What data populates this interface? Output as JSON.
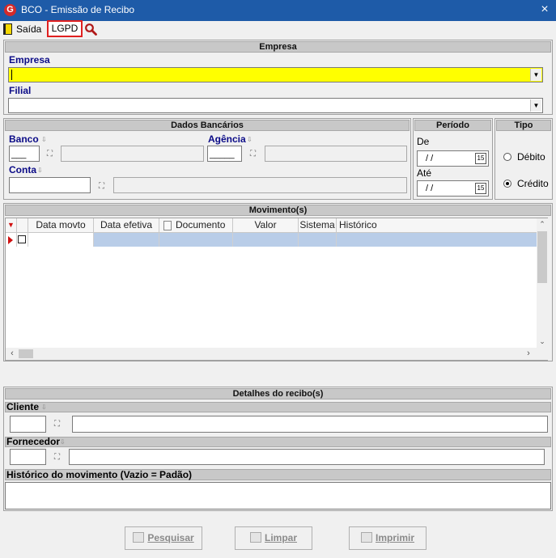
{
  "window": {
    "title": "BCO - Emissão de Recibo",
    "app_icon": "G",
    "close_icon": "×"
  },
  "toolbar": {
    "exit_label": "Saída",
    "lgpd_label": "LGPD"
  },
  "empresa_section": {
    "title": "Empresa",
    "empresa_label": "Empresa",
    "empresa_value": "",
    "filial_label": "Filial",
    "filial_value": ""
  },
  "dados_bancarios": {
    "title": "Dados Bancários",
    "banco_label": "Banco",
    "banco_code": "___",
    "agencia_label": "Agência",
    "agencia_code": "_____",
    "conta_label": "Conta"
  },
  "periodo": {
    "title": "Período",
    "de_label": "De",
    "de_value": "/  /",
    "ate_label": "Até",
    "ate_value": "/  /",
    "cal_icon": "15"
  },
  "tipo": {
    "title": "Tipo",
    "debito_label": "Débito",
    "credito_label": "Crédito",
    "selected": "Crédito"
  },
  "movimentos": {
    "title": "Movimento(s)",
    "columns": [
      "Data movto",
      "Data efetiva",
      "Documento",
      "Valor",
      "Sistema",
      "Histórico"
    ],
    "rows": [
      {
        "data_movto": "",
        "data_efetiva": "",
        "documento": "",
        "valor": "",
        "sistema": "",
        "historico": ""
      }
    ]
  },
  "detalhes": {
    "title": "Detalhes do recibo(s)",
    "cliente_label": "Cliente",
    "fornecedor_label": "Fornecedor",
    "historico_label": "Histórico do movimento (Vazio = Padão)"
  },
  "buttons": {
    "pesquisar": "Pesquisar",
    "limpar": "Limpar",
    "imprimir": "Imprimir"
  },
  "colors": {
    "titlebar": "#1e5ba8",
    "empresa_highlight": "#ffff00",
    "lgpd_border": "#e02020",
    "label_blue": "#0b0b87",
    "grid_selected_row": "#b9cde8"
  }
}
